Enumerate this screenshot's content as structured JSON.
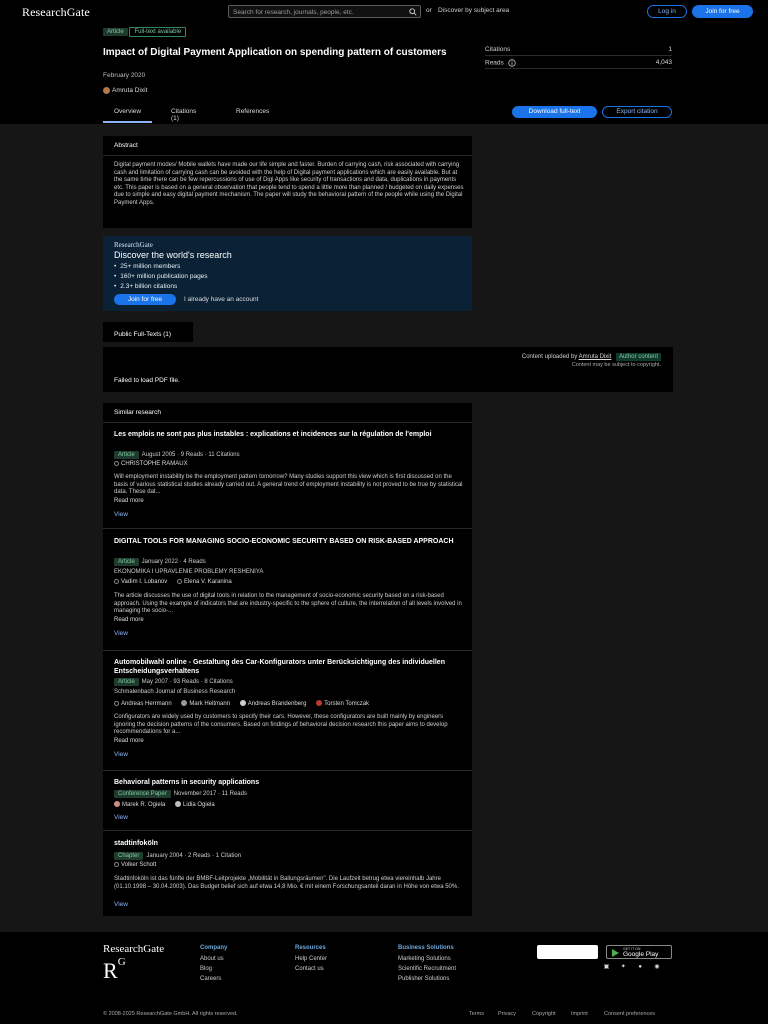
{
  "header": {
    "logo": "ResearchGate",
    "search_placeholder": "Search for research, journals, people, etc.",
    "or": "or",
    "discover": "Discover by subject area",
    "login": "Log in",
    "join": "Join for free"
  },
  "paper": {
    "badge_article": "Article",
    "badge_fulltext": "Full-text available",
    "title": "Impact of Digital Payment Application on spending pattern of customers",
    "date": "February 2020",
    "author": "Amruta Dixit",
    "stats": [
      {
        "label": "Citations",
        "value": "1"
      },
      {
        "label": "Reads",
        "value": "4,043"
      }
    ]
  },
  "tabs": {
    "overview": "Overview",
    "citations": "Citations (1)",
    "references": "References"
  },
  "actions": {
    "download": "Download full-text",
    "export": "Export citation"
  },
  "abstract": {
    "heading": "Abstract",
    "text": "Digital payment modes/ Mobile wallets have made our life simple and faster. Burden of carrying cash, risk associated with carrying cash and limitation of carrying cash can be avoided with the help of Digital payment applications which are easily available. But at the same time there can be few repercussions of use of Digi Apps like security of transactions and data, duplications in payments etc. This paper is based on a general observation that people tend to spend a little more than planned / budgeted on daily expenses due to simple and easy digital payment mechanism. The paper will study the behavioral pattern of the people while using the Digital Payment Apps."
  },
  "promo": {
    "brand": "ResearchGate",
    "heading": "Discover the world's research",
    "bullets": [
      "25+ million members",
      "160+ million publication pages",
      "2.3+ billion citations"
    ],
    "join": "Join for free",
    "already": "I already have an account"
  },
  "fulltext": {
    "tab": "Public Full-Texts (1)",
    "uploaded_prefix": "Content uploaded by",
    "uploader": "Amruta Dixit",
    "role": "Author content",
    "note": "Content may be subject to copyright.",
    "fail": "Failed to load PDF file."
  },
  "similar": {
    "heading": "Similar research",
    "items": [
      {
        "title": "Les emplois ne sont pas plus instables : explications et incidences sur la régulation de l'emploi",
        "badge": "Article",
        "meta": "August 2005 · 9 Reads · 11 Citations",
        "authors": [
          "CHRISTOPHE RAMAUX"
        ],
        "desc": "Will employment instability be the employment pattern tomorrow? Many studies support this view which is first discussed on the basis of various statistical studies already carried out. A general trend of employment instability is not proved to be true by statistical data. These dat...",
        "readmore": "Read more",
        "view": "View"
      },
      {
        "title": "DIGITAL TOOLS FOR MANAGING SOCIO-ECONOMIC SECURITY BASED ON RISK-BASED APPROACH",
        "badge": "Article",
        "meta": "January 2022 · 4 Reads",
        "source": "EKONOMIKA I UPRAVLENIE PROBLEMY RESHENIYA",
        "authors": [
          "Vadim I. Lobanov",
          "Elena V. Karanina"
        ],
        "desc": "The article discusses the use of digital tools in relation to the management of socio-economic security based on a risk-based approach. Using the example of indicators that are industry-specific to the sphere of culture, the interrelation of all levels involved in managing the socio-...",
        "readmore": "Read more",
        "view": "View"
      },
      {
        "title": "Automobilwahl online - Gestaltung des Car-Konfigurators unter Berücksichtigung des individuellen Entscheidungsverhaltens",
        "badge": "Article",
        "meta": "May 2007 · 93 Reads · 8 Citations",
        "source": "Schmalenbach Journal of Business Research",
        "authors": [
          "Andreas Herrmann",
          "Mark Heitmann",
          "Andreas Brandenberg",
          "Torsten Tomczak"
        ],
        "desc": "Configurators are widely used by customers to specify their cars. However, these configurators are built mainly by engineers ignoring the decision patterns of the consumers. Based on findings of behavioral decision research this paper aims to develop recommendations for a...",
        "readmore": "Read more",
        "view": "View"
      },
      {
        "title": "Behavioral patterns in security applications",
        "badge": "Conference Paper",
        "meta": "November 2017 · 11 Reads",
        "authors": [
          "Marek R. Ogiela",
          "Lidia Ogiela"
        ],
        "view": "View"
      },
      {
        "title": "stadtinfoköln",
        "badge": "Chapter",
        "meta": "January 2004 · 2 Reads · 1 Citation",
        "authors": [
          "Volker Schott"
        ],
        "desc": "Stadtinfoköln ist das fünfte der BMBF-Leitprojekte „Mobilität in Ballungsräumen\". Die Laufzeit betrug etwa viereinhalb Jahre (01.10.1998 – 30.04.2003). Das Budget belief sich auf etwa 14,8 Mio. € mit einem Forschungsanteil daran in Höhe von etwa 50%.",
        "view": "View"
      }
    ]
  },
  "footer": {
    "logo": "ResearchGate",
    "mark": "R",
    "mark_sup": "G",
    "cols": [
      {
        "heading": "Company",
        "links": [
          "About us",
          "Blog",
          "Careers"
        ]
      },
      {
        "heading": "Resources",
        "links": [
          "Help Center",
          "Contact us"
        ]
      },
      {
        "heading": "Business Solutions",
        "links": [
          "Marketing Solutions",
          "Scientific Recruitment",
          "Publisher Solutions"
        ]
      }
    ],
    "gp_top": "GET IT ON",
    "gp": "Google Play",
    "copyright": "© 2008-2025 ResearchGate GmbH. All rights reserved.",
    "links": [
      "Terms",
      "Privacy",
      "Copyright",
      "Imprint",
      "Consent preferences"
    ]
  }
}
